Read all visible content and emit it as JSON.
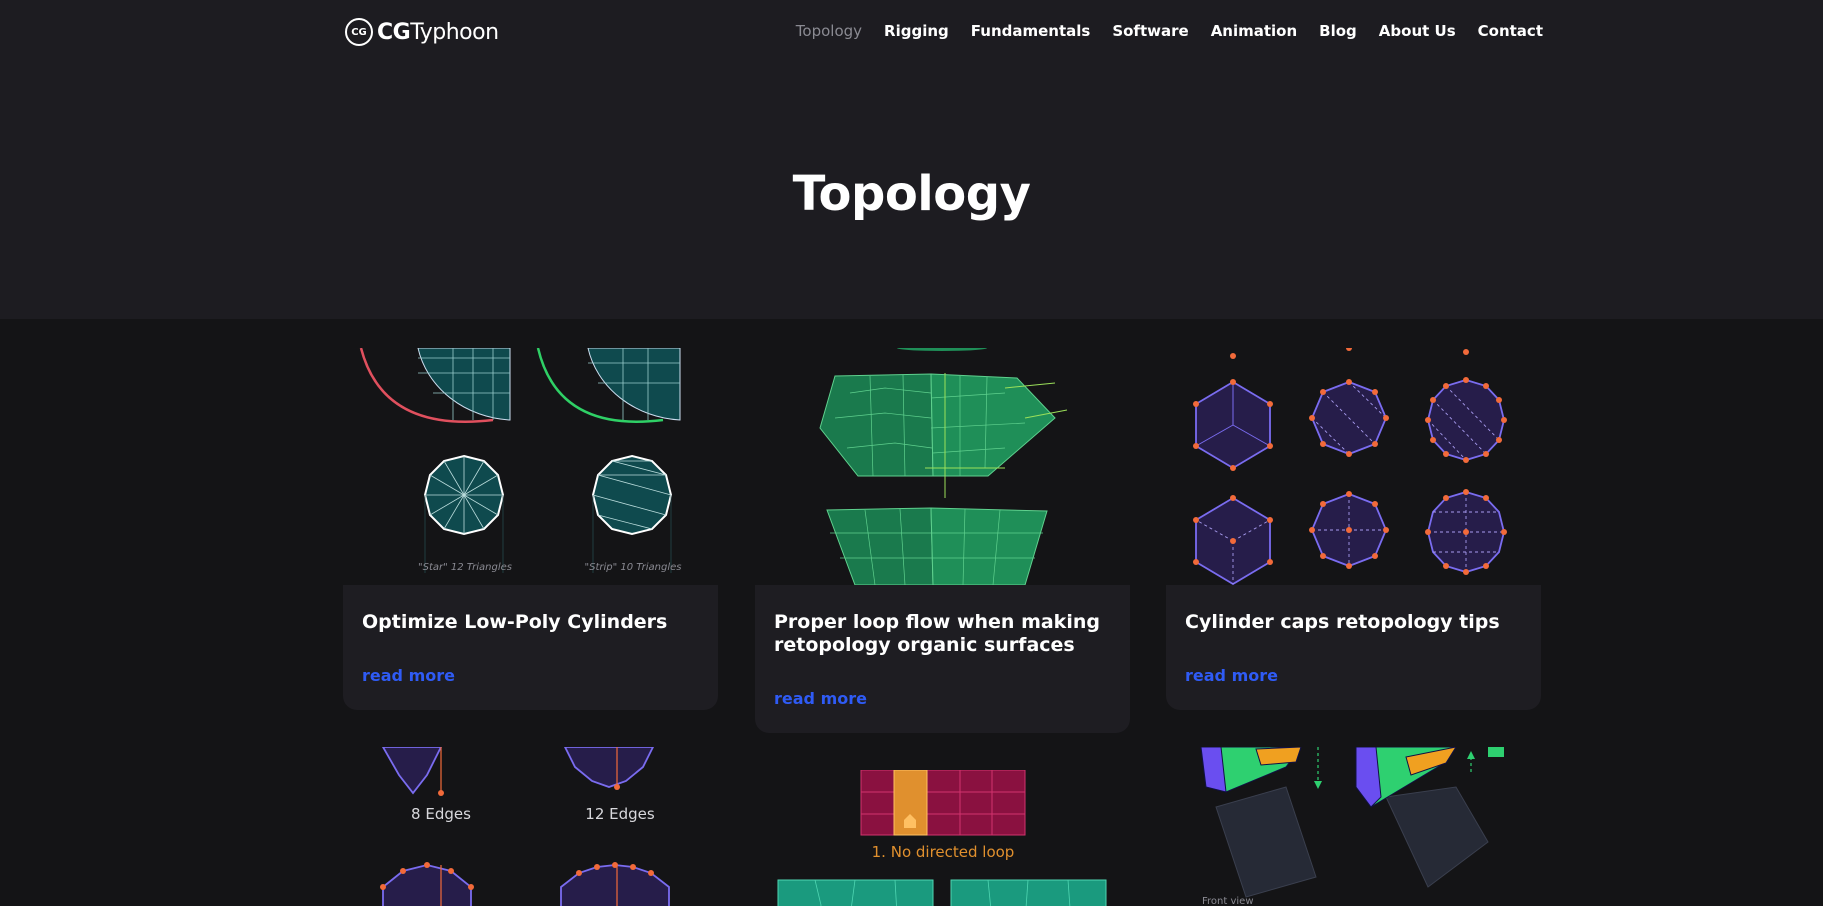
{
  "brand": {
    "badge": "CG",
    "name_bold": "CG",
    "name_rest": "Typhoon"
  },
  "nav": {
    "items": [
      {
        "label": "Topology",
        "active": true
      },
      {
        "label": "Rigging"
      },
      {
        "label": "Fundamentals"
      },
      {
        "label": "Software"
      },
      {
        "label": "Animation"
      },
      {
        "label": "Blog"
      },
      {
        "label": "About Us"
      },
      {
        "label": "Contact"
      }
    ]
  },
  "page": {
    "title": "Topology"
  },
  "cards": [
    {
      "title": "Optimize Low-Poly Cylinders",
      "read_more": "read more",
      "thumb": {
        "label_left": "\"Star\" 12 Triangles",
        "label_right": "\"Strip\" 10 Triangles"
      }
    },
    {
      "title": "Proper loop flow when making retopology organic surfaces",
      "read_more": "read more"
    },
    {
      "title": "Cylinder caps retopology tips",
      "read_more": "read more"
    },
    {
      "thumb": {
        "label_left": "8 Edges",
        "label_right": "12 Edges"
      }
    },
    {
      "thumb": {
        "caption": "1. No directed loop"
      }
    },
    {
      "thumb": {
        "caption": "Front view"
      }
    }
  ],
  "colors": {
    "accent": "#2f5bf5",
    "hero_bg": "#1d1c21",
    "page_bg": "#141416",
    "card_bg": "#1e1d22"
  }
}
